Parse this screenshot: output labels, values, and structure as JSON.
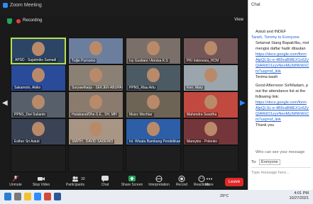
{
  "window": {
    "title": "Zoom Meeting"
  },
  "status": {
    "recording": "Recording",
    "view": "View"
  },
  "participants": [
    {
      "name": "APSD - Sujatmiko Sumadi",
      "bg": "#2c4566",
      "active": true
    },
    {
      "name": "Tuljie Purnomo",
      "bg": "#6c7e9d",
      "active": false
    },
    {
      "name": "Ivy Gustiani / Annisa K.S",
      "bg": "#7b6f6a",
      "active": false
    },
    {
      "name": "PKI Indonesia_HCM",
      "bg": "#735657",
      "active": false
    },
    {
      "name": "Sakamoto, Akiko",
      "bg": "#2a4a9a",
      "active": false
    },
    {
      "name": "Suryawiharja - SEKJEN ABUPAI",
      "bg": "#8b8074",
      "active": false
    },
    {
      "name": "PPNS_Riau Artu",
      "bg": "#4c5a63",
      "active": false
    },
    {
      "name": "Kerr, Mary",
      "bg": "#9aa5ad",
      "active": false
    },
    {
      "name": "PPNS_Dwi Sulianto",
      "bg": "#57606a",
      "active": false
    },
    {
      "name": "Hutabarat/Dhe.S.E., SH, MH",
      "bg": "#8a7b6e",
      "active": false
    },
    {
      "name": "Muizz Mochtar",
      "bg": "#6e6456",
      "active": false
    },
    {
      "name": "Mahendra Swartha",
      "bg": "#c1493f",
      "active": false
    },
    {
      "name": "Esther Sri Astuti",
      "bg": "#3a4255",
      "active": false
    },
    {
      "name": "SMITH.. DAVID SADEWO",
      "bg": "#a89584",
      "active": false
    },
    {
      "name": "Inl. Wisata Bambang Pendidikan",
      "bg": "#2d5ea8",
      "active": false
    },
    {
      "name": "Mareytes - Polenko",
      "bg": "#75363b",
      "active": false
    },
    {
      "name": "",
      "bg": "#1e1e1e",
      "active": false
    },
    {
      "name": "",
      "bg": "#1e1e1e",
      "active": false
    },
    {
      "name": "",
      "bg": "#1e1e1e",
      "active": false
    },
    {
      "name": "",
      "bg": "#1e1e1e",
      "active": false
    }
  ],
  "toolbar": {
    "unmute": "Unmute",
    "video": "Stop Video",
    "participants": "Participants",
    "participants_count": "33",
    "chat": "Chat",
    "share": "Share Screen",
    "interpretation": "Interpretation",
    "record": "Record",
    "reactions": "Reactions",
    "more": "More",
    "leave": "Leave"
  },
  "chat": {
    "title": "Chat",
    "lines": [
      {
        "text": "Astuti and INDEF",
        "type": "text"
      },
      {
        "text": "Taneh, Tommy to Everyone",
        "type": "meta"
      },
      {
        "text": "Selamat Siang Bapak/Ibu, mol",
        "type": "text"
      },
      {
        "text": "mengisi daftar hadir ditautan",
        "type": "text"
      },
      {
        "text": "https://docs.google.com/form",
        "type": "link"
      },
      {
        "text": "AlpQLSc-e-4B5raBMEX1x6Zy",
        "type": "link"
      },
      {
        "text": "QiARdO1zyvNeoMy3dNhWxC",
        "type": "link"
      },
      {
        "text": "m?usp=sf_link",
        "type": "link"
      },
      {
        "text": "Terima kasih",
        "type": "text"
      },
      {
        "text": "Good Afternoon Sir/Madam, p",
        "type": "text"
      },
      {
        "text": "out the attendance list at the",
        "type": "text"
      },
      {
        "text": "following link:",
        "type": "text"
      },
      {
        "text": "https://docs.google.com/form",
        "type": "link"
      },
      {
        "text": "AlpQLSc-e-4B5raBMEX1x6Zy",
        "type": "link"
      },
      {
        "text": "QiARdO1zyvNeoMy3dNhWxC",
        "type": "link"
      },
      {
        "text": "m?usp=sf_link",
        "type": "link"
      },
      {
        "text": "Thank you",
        "type": "text"
      }
    ],
    "who_can_see": "Who can see your message",
    "to_label": "To:",
    "to_value": "Everyone",
    "placeholder": "Type message here..."
  },
  "taskbar": {
    "weather": "29°C",
    "time": "4:01 PM",
    "date": "10/27/2021"
  }
}
